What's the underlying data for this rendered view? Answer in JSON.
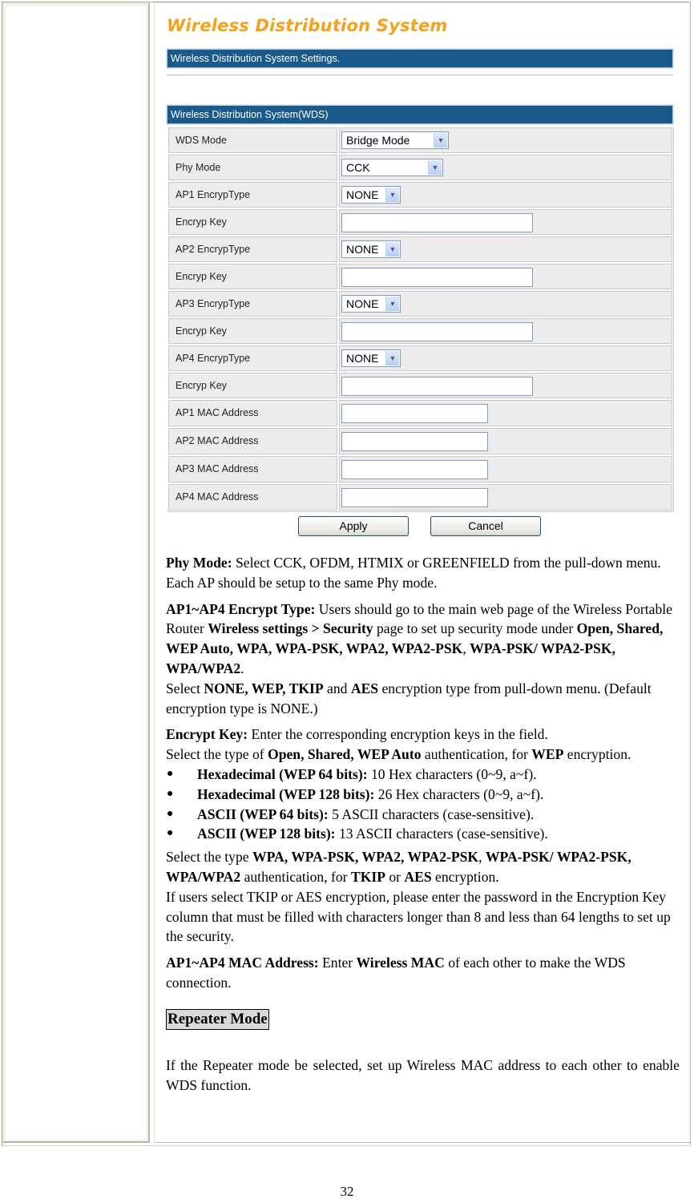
{
  "panel": {
    "title": "Wireless Distribution System",
    "settings_bar": "Wireless Distribution System Settings.",
    "section_bar": "Wireless Distribution System(WDS)",
    "rows": [
      {
        "label": "WDS Mode",
        "type": "select",
        "value": "Bridge Mode"
      },
      {
        "label": "Phy Mode",
        "type": "select",
        "value": "CCK"
      },
      {
        "label": "AP1 EncrypType",
        "type": "select",
        "value": "NONE"
      },
      {
        "label": "Encryp Key",
        "type": "input",
        "value": ""
      },
      {
        "label": "AP2 EncrypType",
        "type": "select",
        "value": "NONE"
      },
      {
        "label": "Encryp Key",
        "type": "input",
        "value": ""
      },
      {
        "label": "AP3 EncrypType",
        "type": "select",
        "value": "NONE"
      },
      {
        "label": "Encryp Key",
        "type": "input",
        "value": ""
      },
      {
        "label": "AP4 EncrypType",
        "type": "select",
        "value": "NONE"
      },
      {
        "label": "Encryp Key",
        "type": "input",
        "value": ""
      },
      {
        "label": "AP1 MAC Address",
        "type": "input",
        "value": ""
      },
      {
        "label": "AP2 MAC Address",
        "type": "input",
        "value": ""
      },
      {
        "label": "AP3 MAC Address",
        "type": "input",
        "value": ""
      },
      {
        "label": "AP4 MAC Address",
        "type": "input",
        "value": ""
      }
    ],
    "apply_label": "Apply",
    "cancel_label": "Cancel",
    "dropdown_icon": "chevron-down-icon"
  },
  "description": {
    "phy_mode": {
      "term": "Phy Mode:",
      "text": " Select CCK, OFDM, HTMIX or GREENFIELD from the pull-down menu. Each AP should be setup to the same Phy mode."
    },
    "encrypt_type": {
      "term": "AP1~AP4 Encrypt Type:",
      "t1": " Users should go to the main web page of the Wireless Portable Router ",
      "b1": "Wireless settings > Security",
      "t2": " page to set up security mode under ",
      "b2": "Open, Shared, WEP Auto, WPA, WPA-PSK, WPA2, WPA2-PSK",
      "t3": ", ",
      "b3": "WPA-PSK/ WPA2-PSK, WPA/WPA2",
      "t4": ".",
      "t5": "Select ",
      "b4": "NONE, WEP, TKIP",
      "t6": " and ",
      "b5": "AES",
      "t7": "  encryption type from pull-down menu. (Default encryption type is NONE.)"
    },
    "encrypt_key": {
      "term": "Encrypt Key:",
      "t1": " Enter the corresponding encryption keys in the field.",
      "t2": "Select the type of ",
      "b1": "Open, Shared, WEP Auto",
      "t3": " authentication, for ",
      "b2": "WEP",
      "t4": " encryption.",
      "bullets": [
        {
          "term": "Hexadecimal (WEP 64 bits):",
          "text": " 10 Hex characters (0~9, a~f)."
        },
        {
          "term": "Hexadecimal (WEP 128 bits):",
          "text": " 26 Hex characters (0~9, a~f)."
        },
        {
          "term": "ASCII (WEP 64 bits):",
          "text": " 5 ASCII characters (case-sensitive)."
        },
        {
          "term": "ASCII (WEP 128 bits):",
          "text": " 13 ASCII characters (case-sensitive)."
        }
      ],
      "bullet_glyph": "●"
    },
    "wpa": {
      "t1": "Select the type ",
      "b1": "WPA, WPA-PSK, WPA2, WPA2-PSK",
      "t2": ", ",
      "b2": "WPA-PSK/ WPA2-PSK, WPA/WPA2",
      "t3": " authentication, for  ",
      "b3": "TKIP",
      "t4": " or ",
      "b4": "AES",
      "t5": " encryption.",
      "t6": "If users select TKIP or AES encryption, please enter the password in the Encryption Key column that must be filled with characters longer than 8 and less than 64 lengths to set up the security."
    },
    "mac": {
      "term": "AP1~AP4 MAC Address:",
      "t1": " Enter ",
      "b1": "Wireless MAC",
      "t2": " of each other to make the WDS connection."
    },
    "repeater_heading": "Repeater Mode",
    "repeater_text": "If the Repeater mode be selected, set up Wireless MAC address to each other to enable WDS function."
  },
  "page_number": "32"
}
